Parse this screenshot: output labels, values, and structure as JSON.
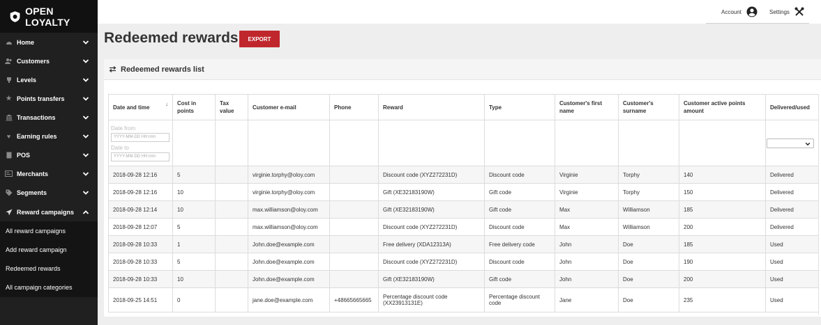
{
  "brand": {
    "name": "OPEN LOYALTY"
  },
  "sidebar": {
    "items": [
      {
        "label": "Home",
        "icon": "dashboard-icon"
      },
      {
        "label": "Customers",
        "icon": "users-icon"
      },
      {
        "label": "Levels",
        "icon": "trophy-icon"
      },
      {
        "label": "Points transfers",
        "icon": "star-icon"
      },
      {
        "label": "Transactions",
        "icon": "bank-icon"
      },
      {
        "label": "Earning rules",
        "icon": "heart-icon"
      },
      {
        "label": "POS",
        "icon": "pos-icon"
      },
      {
        "label": "Merchants",
        "icon": "merchant-icon"
      },
      {
        "label": "Segments",
        "icon": "tag-icon"
      },
      {
        "label": "Reward campaigns",
        "icon": "send-icon"
      }
    ],
    "sub_items": [
      {
        "label": "All reward campaigns"
      },
      {
        "label": "Add reward campaign"
      },
      {
        "label": "Redeemed rewards"
      },
      {
        "label": "All campaign categories"
      }
    ]
  },
  "header": {
    "account_label": "Account",
    "settings_label": "Settings"
  },
  "page": {
    "title": "Redeemed rewards",
    "export_label": "EXPORT",
    "card_title": "Redeemed rewards list"
  },
  "table": {
    "columns": [
      "Date and time",
      "Cost in points",
      "Tax value",
      "Customer e-mail",
      "Phone",
      "Reward",
      "Type",
      "Customer's first name",
      "Customer's surname",
      "Customer active points amount",
      "Delivered/used"
    ],
    "filters": {
      "date_from_label": "Date from",
      "date_to_label": "Date to",
      "date_placeholder": "YYYY-MM-DD HH:mm",
      "delivered_selected": ""
    },
    "rows": [
      [
        "2018-09-28 12:16",
        "5",
        "",
        "virginie.torphy@oloy.com",
        "",
        "Discount code (XYZ272231D)",
        "Discount code",
        "Virginie",
        "Torphy",
        "140",
        "Delivered"
      ],
      [
        "2018-09-28 12:16",
        "10",
        "",
        "virginie.torphy@oloy.com",
        "",
        "Gift (XE32183190W)",
        "Gift code",
        "Virginie",
        "Torphy",
        "150",
        "Delivered"
      ],
      [
        "2018-09-28 12:14",
        "10",
        "",
        "max.williamson@oloy.com",
        "",
        "Gift (XE32183190W)",
        "Gift code",
        "Max",
        "Williamson",
        "185",
        "Delivered"
      ],
      [
        "2018-09-28 12:07",
        "5",
        "",
        "max.williamson@oloy.com",
        "",
        "Discount code (XYZ272231D)",
        "Discount code",
        "Max",
        "Williamson",
        "200",
        "Delivered"
      ],
      [
        "2018-09-28 10:33",
        "1",
        "",
        "John.doe@example.com",
        "",
        "Free delivery (XDA12313A)",
        "Free delivery code",
        "John",
        "Doe",
        "185",
        "Used"
      ],
      [
        "2018-09-28 10:33",
        "5",
        "",
        "John.doe@example.com",
        "",
        "Discount code (XYZ272231D)",
        "Discount code",
        "John",
        "Doe",
        "190",
        "Used"
      ],
      [
        "2018-09-28 10:33",
        "10",
        "",
        "John.doe@example.com",
        "",
        "Gift (XE32183190W)",
        "Gift code",
        "John",
        "Doe",
        "200",
        "Used"
      ],
      [
        "2018-09-25 14:51",
        "0",
        "",
        "jane.doe@example.com",
        "+48665665665",
        "Percentage discount code (XX23913131E)",
        "Percentage discount code",
        "Jane",
        "Doe",
        "235",
        "Used"
      ]
    ]
  },
  "colors": {
    "sidebar_bg": "#202020",
    "export_btn": "#c0272d",
    "page_bg": "#eeeeee"
  }
}
